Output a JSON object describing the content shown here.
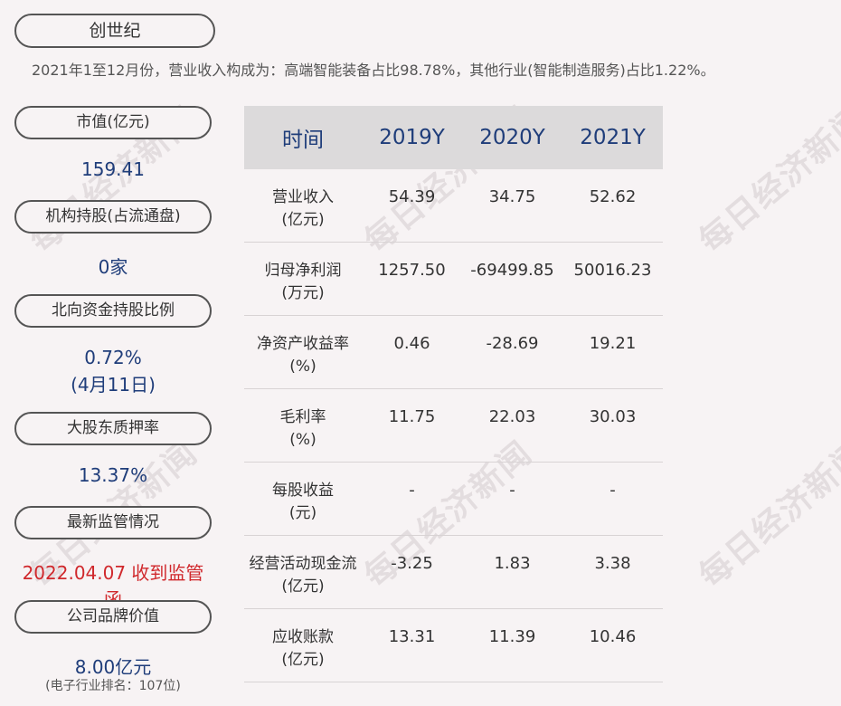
{
  "company": "创世纪",
  "summary": "2021年1至12月份，营业收入构成为：高端智能装备占比98.78%，其他行业(智能制造服务)占比1.22%。",
  "sidebar": [
    {
      "label": "市值(亿元)",
      "value": "159.41"
    },
    {
      "label": "机构持股(占流通盘)",
      "value": "0家"
    },
    {
      "label": "北向资金持股比例",
      "value": "0.72%",
      "value2": "(4月11日)"
    },
    {
      "label": "大股东质押率",
      "value": "13.37%"
    },
    {
      "label": "最新监管情况",
      "value": "2022.04.07 收到监管函"
    },
    {
      "label": "公司品牌价值",
      "value": "8.00亿元",
      "note": "(电子行业排名：107位)"
    }
  ],
  "table": {
    "headers": [
      "时间",
      "2019Y",
      "2020Y",
      "2021Y"
    ],
    "rows": [
      {
        "metric": "营业收入",
        "unit": "(亿元)",
        "values": [
          "54.39",
          "34.75",
          "52.62"
        ]
      },
      {
        "metric": "归母净利润",
        "unit": "(万元)",
        "values": [
          "1257.50",
          "-69499.85",
          "50016.23"
        ]
      },
      {
        "metric": "净资产收益率",
        "unit": "(%)",
        "values": [
          "0.46",
          "-28.69",
          "19.21"
        ]
      },
      {
        "metric": "毛利率",
        "unit": "(%)",
        "values": [
          "11.75",
          "22.03",
          "30.03"
        ]
      },
      {
        "metric": "每股收益",
        "unit": "(元)",
        "values": [
          "-",
          "-",
          "-"
        ]
      },
      {
        "metric": "经营活动现金流",
        "unit": "(亿元)",
        "values": [
          "-3.25",
          "1.83",
          "3.38"
        ]
      },
      {
        "metric": "应收账款",
        "unit": "(亿元)",
        "values": [
          "13.31",
          "11.39",
          "10.46"
        ]
      }
    ]
  },
  "watermark": "每日经济新闻"
}
